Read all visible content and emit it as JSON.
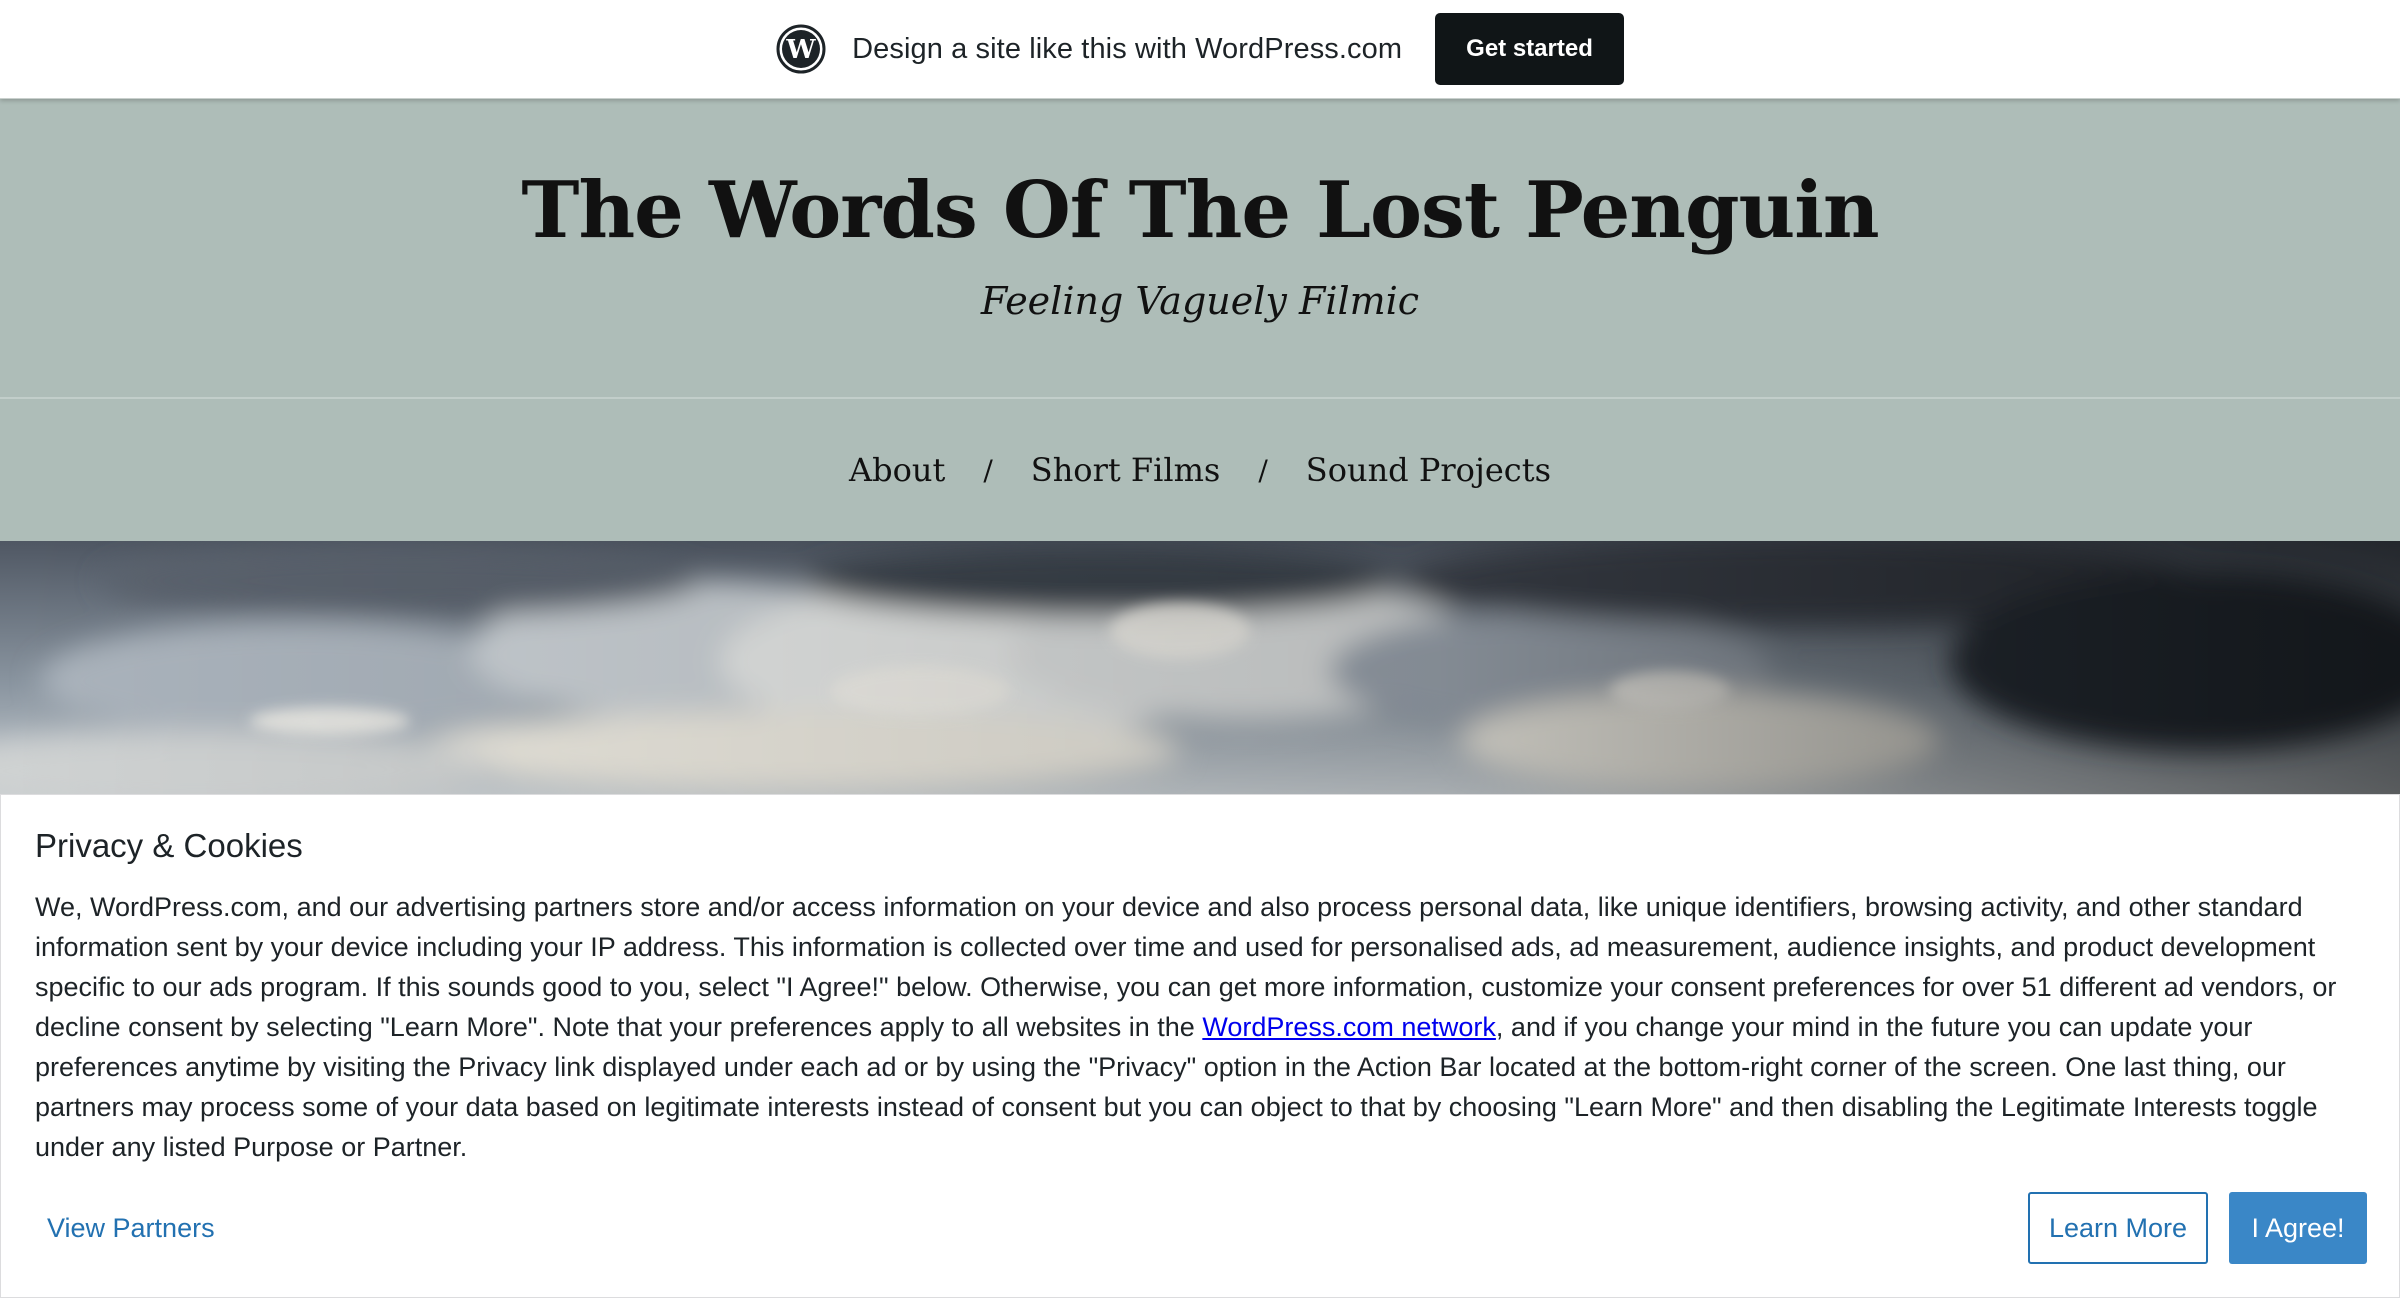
{
  "wp_banner": {
    "logo_icon": "wordpress-logo-icon",
    "tagline": "Design a site like this with WordPress.com",
    "cta_label": "Get started"
  },
  "header": {
    "title": "The Words Of The Lost Penguin",
    "description": "Feeling Vaguely Filmic"
  },
  "nav": {
    "items": [
      {
        "label": "About"
      },
      {
        "label": "Short Films"
      },
      {
        "label": "Sound Projects"
      }
    ],
    "separator": "/"
  },
  "cookie": {
    "title": "Privacy & Cookies",
    "text_before_link": "We, WordPress.com, and our advertising partners store and/or access information on your device and also process personal data, like unique identifiers, browsing activity, and other standard information sent by your device including your IP address. This information is collected over time and used for personalised ads, ad measurement, audience insights, and product development specific to our ads program. If this sounds good to you, select \"I Agree!\" below. Otherwise, you can get more information, customize your consent preferences for over 51 different ad vendors, or decline consent by selecting \"Learn More\". Note that your preferences apply to all websites in the ",
    "link_text": "WordPress.com network",
    "text_after_link": ", and if you change your mind in the future you can update your preferences anytime by visiting the Privacy link displayed under each ad or by using the \"Privacy\" option in the Action Bar located at the bottom-right corner of the screen. One last thing, our partners may process some of your data based on legitimate interests instead of consent but you can object to that by choosing \"Learn More\" and then disabling the Legitimate Interests toggle under any listed Purpose or Partner.",
    "view_partners_label": "View Partners",
    "learn_more_label": "Learn More",
    "agree_label": "I Agree!"
  },
  "colors": {
    "header_bg": "#aebdb8",
    "banner_button_bg": "#101517",
    "cookie_link": "#2271b1",
    "agree_bg": "#3a87c7"
  }
}
